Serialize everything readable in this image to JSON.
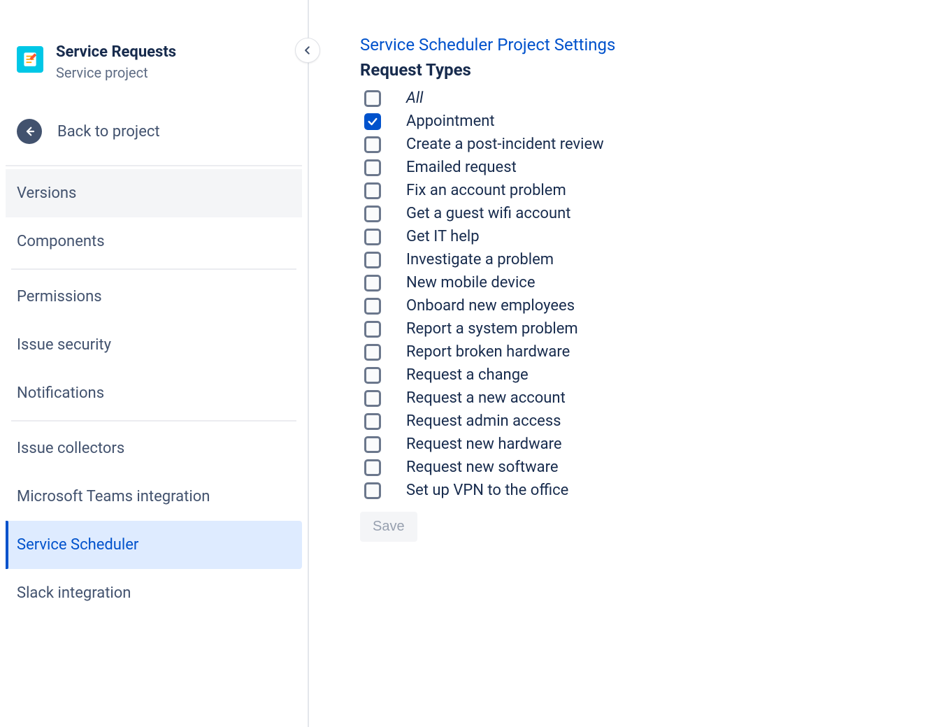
{
  "sidebar": {
    "project_title": "Service Requests",
    "project_subtitle": "Service project",
    "back_label": "Back to project",
    "nav": [
      {
        "label": "Versions",
        "highlight": true
      },
      {
        "label": "Components"
      },
      {
        "label": "Permissions"
      },
      {
        "label": "Issue security"
      },
      {
        "label": "Notifications"
      },
      {
        "label": "Issue collectors"
      },
      {
        "label": "Microsoft Teams integration"
      },
      {
        "label": "Service Scheduler",
        "selected": true
      },
      {
        "label": "Slack integration"
      }
    ]
  },
  "main": {
    "breadcrumb": "Service Scheduler Project Settings",
    "heading": "Request Types",
    "items": [
      {
        "label": "All",
        "italic": true,
        "checked": false
      },
      {
        "label": "Appointment",
        "checked": true
      },
      {
        "label": "Create a post-incident review",
        "checked": false
      },
      {
        "label": "Emailed request",
        "checked": false
      },
      {
        "label": "Fix an account problem",
        "checked": false
      },
      {
        "label": "Get a guest wifi account",
        "checked": false
      },
      {
        "label": "Get IT help",
        "checked": false
      },
      {
        "label": "Investigate a problem",
        "checked": false
      },
      {
        "label": "New mobile device",
        "checked": false
      },
      {
        "label": "Onboard new employees",
        "checked": false
      },
      {
        "label": "Report a system problem",
        "checked": false
      },
      {
        "label": "Report broken hardware",
        "checked": false
      },
      {
        "label": "Request a change",
        "checked": false
      },
      {
        "label": "Request a new account",
        "checked": false
      },
      {
        "label": "Request admin access",
        "checked": false
      },
      {
        "label": "Request new hardware",
        "checked": false
      },
      {
        "label": "Request new software",
        "checked": false
      },
      {
        "label": "Set up VPN to the office",
        "checked": false
      }
    ],
    "save_label": "Save"
  }
}
